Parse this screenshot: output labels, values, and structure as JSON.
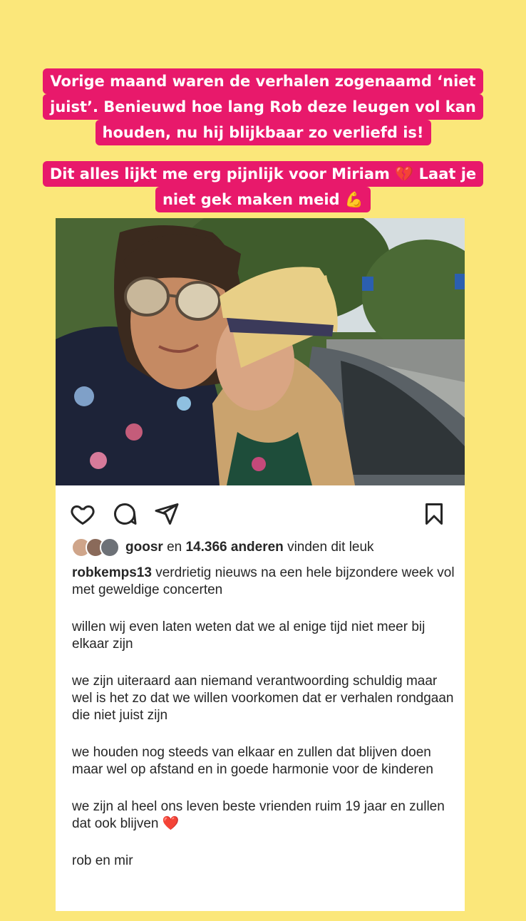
{
  "story": {
    "caption1_lines": [
      "Vorige maand waren de verhalen zogenaamd ‘niet",
      "juist’. Benieuwd hoe lang Rob deze leugen vol kan",
      "houden, nu hij blijkbaar zo verliefd is!"
    ],
    "caption2_lines": [
      "Dit alles lijkt me erg pijnlijk voor Miriam 💔 Laat je",
      "niet gek maken meid 💪"
    ],
    "background_color": "#fbe77a",
    "caption_color": "#e8196b"
  },
  "post": {
    "actions": {
      "like_icon": "heart-icon",
      "comment_icon": "comment-icon",
      "share_icon": "share-icon",
      "save_icon": "bookmark-icon"
    },
    "likes": {
      "user": "goosr",
      "connector": "en",
      "count_text": "14.366 anderen",
      "suffix": "vinden dit leuk"
    },
    "caption": {
      "username": "robkemps13",
      "paragraphs": [
        "verdrietig nieuws na een hele bijzondere week vol met geweldige concerten",
        "willen wij even laten weten dat we al enige tijd niet meer bij elkaar zijn",
        "we zijn uiteraard aan niemand verantwoording schuldig maar wel is het zo dat we willen voorkomen dat er verhalen rondgaan die niet juist zijn",
        "we houden nog steeds van elkaar en zullen dat blijven doen",
        "maar wel op afstand en in goede harmonie voor de kinderen",
        "we zijn al heel ons leven beste vrienden ruim 19 jaar en zullen dat ook blijven",
        "rob en mir"
      ],
      "heart_emoji": "❤️"
    }
  }
}
